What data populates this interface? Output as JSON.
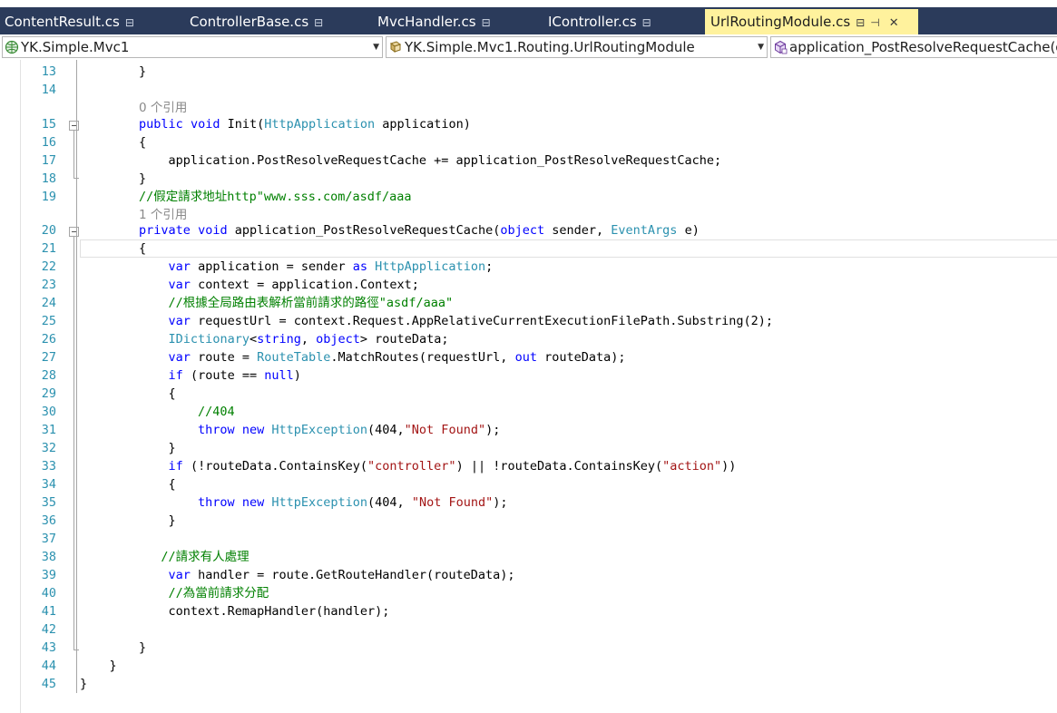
{
  "tabs": [
    {
      "label": "ContentResult.cs",
      "pin": "⊟"
    },
    {
      "label": "ControllerBase.cs",
      "pin": "⊟"
    },
    {
      "label": "MvcHandler.cs",
      "pin": "⊟"
    },
    {
      "label": "IController.cs",
      "pin": "⊟"
    },
    {
      "label": "UrlRoutingModule.cs",
      "pin": "⊟",
      "dock": "⊣",
      "close": "✕"
    }
  ],
  "nav": {
    "project": "YK.Simple.Mvc1",
    "type": "YK.Simple.Mvc1.Routing.UrlRoutingModule",
    "member": "application_PostResolveRequestCache(o"
  },
  "codelens": {
    "ref0": "0 个引用",
    "ref1": "1 个引用"
  },
  "line_numbers": [
    "13",
    "14",
    "15",
    "16",
    "17",
    "18",
    "19",
    "20",
    "21",
    "22",
    "23",
    "24",
    "25",
    "26",
    "27",
    "28",
    "29",
    "30",
    "31",
    "32",
    "33",
    "34",
    "35",
    "36",
    "37",
    "38",
    "39",
    "40",
    "41",
    "42",
    "43",
    "44",
    "45"
  ],
  "code": {
    "l13_brace": "}",
    "l15_kw1": "public",
    "l15_kw2": "void",
    "l15_name": "Init(",
    "l15_type": "HttpApplication",
    "l15_rest": " application)",
    "l16": "{",
    "l17": "application.PostResolveRequestCache += application_PostResolveRequestCache;",
    "l18": "}",
    "l19": "//假定請求地址http\"www.sss.com/asdf/aaa",
    "l20_kw1": "private",
    "l20_kw2": "void",
    "l20_name": "application_PostResolveRequestCache(",
    "l20_kw3": "object",
    "l20_mid": " sender, ",
    "l20_type": "EventArgs",
    "l20_end": " e)",
    "l21": "{",
    "l22_kw": "var",
    "l22_mid": " application = sender ",
    "l22_kw2": "as",
    "l22_type": "HttpApplication",
    "l22_end": ";",
    "l23_kw": "var",
    "l23_rest": " context = application.Context;",
    "l24": "//根據全局路由表解析當前請求的路徑\"asdf/aaa\"",
    "l25_kw": "var",
    "l25_rest": " requestUrl = context.Request.AppRelativeCurrentExecutionFilePath.Substring(2);",
    "l26_type": "IDictionary",
    "l26_lt": "<",
    "l26_kw1": "string",
    "l26_comma": ", ",
    "l26_kw2": "object",
    "l26_rest": "> routeData;",
    "l27_kw": "var",
    "l27_mid": " route = ",
    "l27_type": "RouteTable",
    "l27_mid2": ".MatchRoutes(requestUrl, ",
    "l27_kw2": "out",
    "l27_end": " routeData);",
    "l28_kw": "if",
    "l28_mid": " (route == ",
    "l28_kw2": "null",
    "l28_end": ")",
    "l29": "{",
    "l30": "//404",
    "l31_kw1": "throw",
    "l31_kw2": "new",
    "l31_type": "HttpException",
    "l31_mid": "(404,",
    "l31_str": "\"Not Found\"",
    "l31_end": ");",
    "l32": "}",
    "l33_kw": "if",
    "l33_mid": " (!routeData.ContainsKey(",
    "l33_str1": "\"controller\"",
    "l33_mid2": ") || !routeData.ContainsKey(",
    "l33_str2": "\"action\"",
    "l33_end": "))",
    "l34": "{",
    "l35_kw1": "throw",
    "l35_kw2": "new",
    "l35_type": "HttpException",
    "l35_mid": "(404, ",
    "l35_str": "\"Not Found\"",
    "l35_end": ");",
    "l36": "}",
    "l38": "//請求有人處理",
    "l39_kw": "var",
    "l39_rest": " handler = route.GetRouteHandler(routeData);",
    "l40": "//為當前請求分配",
    "l41": "context.RemapHandler(handler);",
    "l43": "}",
    "l44": "}",
    "l45": "}"
  }
}
